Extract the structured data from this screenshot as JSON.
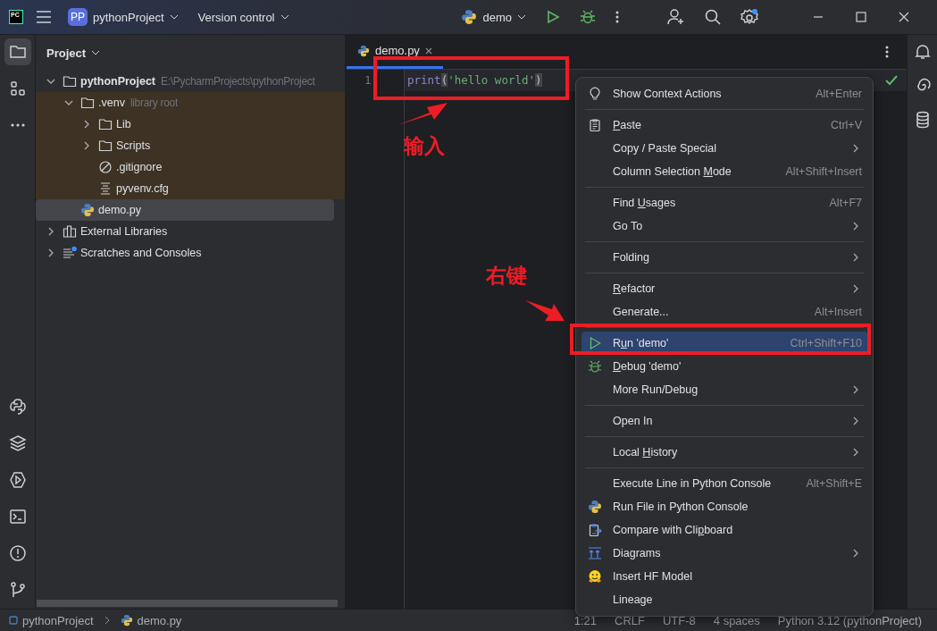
{
  "title_bar": {
    "logo": "PC",
    "project_badge": "PP",
    "project": "pythonProject",
    "vcs": "Version control",
    "run_config": "demo",
    "settings_badge": true
  },
  "left_toolbar_top": [
    {
      "kind": "folder",
      "selected": true
    },
    {
      "kind": "structure",
      "selected": false
    },
    {
      "kind": "more",
      "selected": false
    }
  ],
  "left_toolbar_bottom": [
    {
      "kind": "python",
      "selected": false
    },
    {
      "kind": "layers",
      "selected": false
    },
    {
      "kind": "services",
      "selected": false
    },
    {
      "kind": "terminal",
      "selected": false
    },
    {
      "kind": "problems",
      "selected": false
    },
    {
      "kind": "git",
      "selected": false
    }
  ],
  "project_panel": {
    "title": "Project",
    "tree": [
      {
        "label": "pythonProject",
        "hint": "E:\\PycharmProjects\\pythonProject",
        "kind": "folder",
        "project_root": true,
        "expanded": true,
        "selected": false,
        "children": [
          {
            "label": ".venv",
            "hint": "library root",
            "kind": "folder",
            "library_root": true,
            "expanded": true,
            "selected": false,
            "children": [
              {
                "label": "Lib",
                "kind": "folder",
                "expanded": false,
                "selected": false
              },
              {
                "label": "Scripts",
                "kind": "folder",
                "expanded": false,
                "selected": false
              },
              {
                "label": ".gitignore",
                "kind": "ignore",
                "selected": false
              },
              {
                "label": "pyvenv.cfg",
                "kind": "text",
                "selected": false
              }
            ]
          },
          {
            "label": "demo.py",
            "kind": "python",
            "selected": true
          }
        ]
      },
      {
        "label": "External Libraries",
        "kind": "library",
        "expanded": false,
        "selected": false
      },
      {
        "label": "Scratches and Consoles",
        "kind": "scratches",
        "expanded": false,
        "selected": false
      }
    ]
  },
  "editor": {
    "tabs": [
      {
        "label": "demo.py",
        "selected": true
      }
    ],
    "lines": [
      {
        "number": "1",
        "tokens": [
          {
            "kind": "builtin",
            "text": "print"
          },
          {
            "kind": "brace",
            "text": "("
          },
          {
            "kind": "string",
            "text": "'hello world'"
          },
          {
            "kind": "brace",
            "text": ")"
          }
        ]
      }
    ]
  },
  "right_toolbar": [
    {
      "kind": "bell"
    },
    {
      "kind": "spiral"
    },
    {
      "kind": "database"
    }
  ],
  "context_menu": [
    {
      "kind": "bulb",
      "label": {
        "pre": "Show Context Actions"
      },
      "shortcut": "Alt+Enter",
      "submenu": false,
      "selected": false
    },
    {
      "kind": "separator"
    },
    {
      "kind": "clipboard",
      "label": {
        "key": "P",
        "post": "aste"
      },
      "shortcut": "Ctrl+V",
      "submenu": false,
      "selected": false
    },
    {
      "kind": "item",
      "label": {
        "pre": "Copy / Paste Special"
      },
      "submenu": true,
      "selected": false
    },
    {
      "kind": "item",
      "label": {
        "pre": "Column Selection ",
        "key": "M",
        "post": "ode"
      },
      "shortcut": "Alt+Shift+Insert",
      "submenu": false,
      "selected": false
    },
    {
      "kind": "separator"
    },
    {
      "kind": "item",
      "label": {
        "pre": "Find ",
        "key": "U",
        "post": "sages"
      },
      "shortcut": "Alt+F7",
      "submenu": false,
      "selected": false
    },
    {
      "kind": "item",
      "label": {
        "pre": "Go To"
      },
      "submenu": true,
      "selected": false
    },
    {
      "kind": "separator"
    },
    {
      "kind": "item",
      "label": {
        "pre": "Folding"
      },
      "submenu": true,
      "selected": false
    },
    {
      "kind": "separator"
    },
    {
      "kind": "item",
      "label": {
        "key": "R",
        "post": "efactor"
      },
      "submenu": true,
      "selected": false
    },
    {
      "kind": "item",
      "label": {
        "pre": "Generate..."
      },
      "shortcut": "Alt+Insert",
      "submenu": false,
      "selected": false
    },
    {
      "kind": "separator"
    },
    {
      "kind": "run",
      "label": {
        "pre": "R",
        "key": "u",
        "post": "n 'demo'"
      },
      "shortcut": "Ctrl+Shift+F10",
      "submenu": false,
      "selected": true
    },
    {
      "kind": "bug",
      "label": {
        "key": "D",
        "post": "ebug 'demo'"
      },
      "submenu": false,
      "selected": false
    },
    {
      "kind": "item",
      "label": {
        "pre": "More Run/Debug"
      },
      "submenu": true,
      "selected": false
    },
    {
      "kind": "separator"
    },
    {
      "kind": "item",
      "label": {
        "pre": "Open In"
      },
      "submenu": true,
      "selected": false
    },
    {
      "kind": "separator"
    },
    {
      "kind": "item",
      "label": {
        "pre": "Local ",
        "key": "H",
        "post": "istory"
      },
      "submenu": true,
      "selected": false
    },
    {
      "kind": "separator"
    },
    {
      "kind": "item",
      "label": {
        "pre": "Execute Line in Python Console"
      },
      "shortcut": "Alt+Shift+E",
      "submenu": false,
      "selected": false
    },
    {
      "kind": "python",
      "label": {
        "pre": "Run File in Python Console"
      },
      "submenu": false,
      "selected": false
    },
    {
      "kind": "compare",
      "label": {
        "pre": "Compare with Cli",
        "key": "p",
        "post": "board"
      },
      "submenu": false,
      "selected": false
    },
    {
      "kind": "diagrams",
      "label": {
        "pre": "Diagrams"
      },
      "submenu": true,
      "selected": false
    },
    {
      "kind": "hf",
      "label": {
        "pre": "Insert HF Model"
      },
      "submenu": false,
      "selected": false
    },
    {
      "kind": "item",
      "label": {
        "pre": "Lineage"
      },
      "submenu": false,
      "selected": false
    }
  ],
  "status_bar": {
    "breadcrumbs": [
      {
        "kind": "module",
        "label": "pythonProject"
      },
      {
        "kind": "python",
        "label": "demo.py"
      }
    ],
    "items": [
      "1:21",
      "CRLF",
      "UTF-8",
      "4 spaces",
      "Python 3.12 (pythonProject)"
    ]
  },
  "annotations": [
    {
      "kind": "code",
      "label": "输入"
    },
    {
      "kind": "menu",
      "label": "右键"
    }
  ]
}
